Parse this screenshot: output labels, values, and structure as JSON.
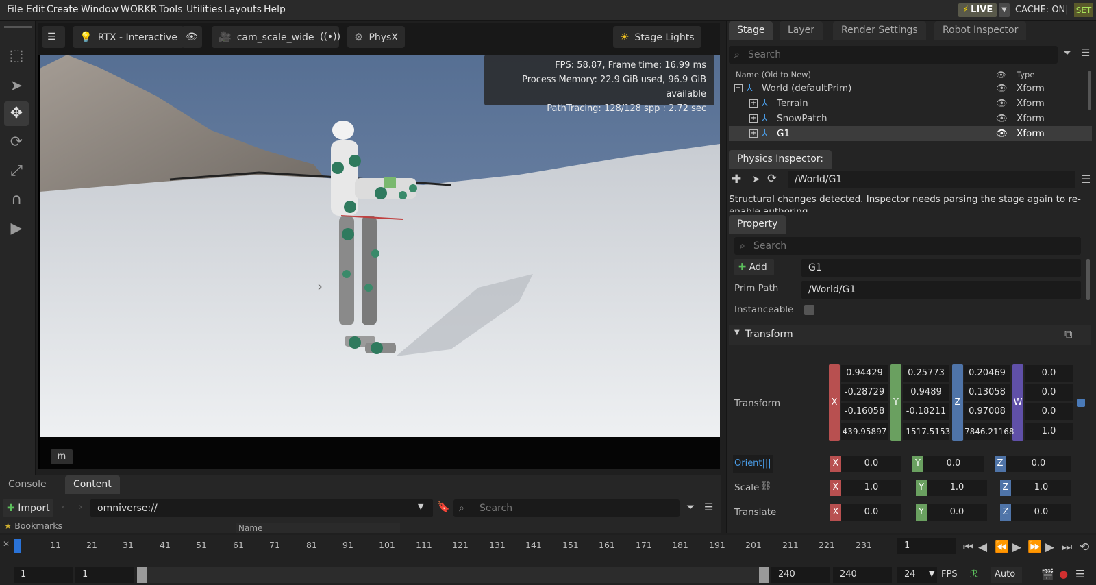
{
  "menu": [
    "File",
    "Edit",
    "Create",
    "Window",
    "WORKR",
    "Tools",
    "Utilities",
    "Layouts",
    "Help"
  ],
  "status": {
    "live": "LIVE",
    "cache": "CACHE: ON|",
    "set": "SET"
  },
  "viewport": {
    "renderer": "RTX - Interactive",
    "camera": "cam_scale_wide",
    "physics": "PhysX",
    "lights": "Stage Lights",
    "fps": "FPS: 58.87, Frame time: 16.99 ms",
    "memory": "Process Memory: 22.9 GiB used, 96.9 GiB available",
    "pathtracing": "PathTracing: 128/128 spp : 2.72 sec",
    "unit": "m"
  },
  "stage": {
    "tabs": [
      "Stage",
      "Layer",
      "Render Settings",
      "Robot Inspector"
    ],
    "search_placeholder": "Search",
    "col_name": "Name (Old to New)",
    "col_type": "Type",
    "rows": [
      {
        "name": "World (defaultPrim)",
        "type": "Xform",
        "pm": "−"
      },
      {
        "name": "Terrain",
        "type": "Xform",
        "pm": "+"
      },
      {
        "name": "SnowPatch",
        "type": "Xform",
        "pm": "+"
      },
      {
        "name": "G1",
        "type": "Xform",
        "pm": "+"
      }
    ]
  },
  "physics_inspector": {
    "title": "Physics Inspector:",
    "path": "/World/G1",
    "message": "Structural changes detected. Inspector needs parsing the stage again to re-enable authoring"
  },
  "property": {
    "tab": "Property",
    "search_placeholder": "Search",
    "add_label": "Add",
    "name_value": "G1",
    "prim_path_label": "Prim Path",
    "prim_path_value": "/World/G1",
    "instanceable_label": "Instanceable",
    "transform_section": "Transform",
    "transform_label": "Transform",
    "matrix": [
      [
        "0.94429",
        "0.25773",
        "0.20469",
        "0.0"
      ],
      [
        "-0.28729",
        "0.9489",
        "0.13058",
        "0.0"
      ],
      [
        "-0.16058",
        "-0.18211",
        "0.97008",
        "0.0"
      ],
      [
        "439.95897",
        "-1517.5153",
        "7846.21168",
        "1.0"
      ]
    ],
    "axes": [
      "X",
      "Y",
      "Z",
      "W"
    ],
    "orient_label": "Orient",
    "orient": [
      "0.0",
      "0.0",
      "0.0"
    ],
    "scale_label": "Scale",
    "scale": [
      "1.0",
      "1.0",
      "1.0"
    ],
    "translate_label": "Translate",
    "translate": [
      "0.0",
      "0.0",
      "0.0"
    ]
  },
  "bottom": {
    "tabs": [
      "Console",
      "Content"
    ],
    "import_label": "Import",
    "path": "omniverse://",
    "search_placeholder": "Search",
    "bookmarks": "Bookmarks",
    "name_col": "Name"
  },
  "timeline": {
    "ticks": [
      "11",
      "21",
      "31",
      "41",
      "51",
      "61",
      "71",
      "81",
      "91",
      "101",
      "111",
      "121",
      "131",
      "141",
      "151",
      "161",
      "171",
      "181",
      "191",
      "201",
      "211",
      "221",
      "231"
    ],
    "current_frame": "1",
    "start": "1",
    "start2": "1",
    "end": "240",
    "end2": "240",
    "fps": "24",
    "fps_label": "FPS",
    "auto": "Auto"
  }
}
